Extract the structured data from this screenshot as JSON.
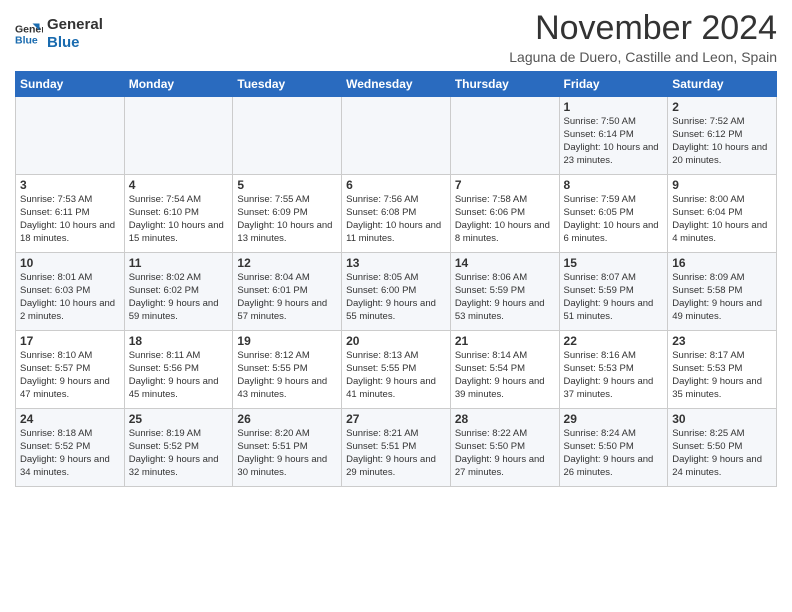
{
  "header": {
    "logo_line1": "General",
    "logo_line2": "Blue",
    "month": "November 2024",
    "location": "Laguna de Duero, Castille and Leon, Spain"
  },
  "weekdays": [
    "Sunday",
    "Monday",
    "Tuesday",
    "Wednesday",
    "Thursday",
    "Friday",
    "Saturday"
  ],
  "weeks": [
    [
      {
        "day": "",
        "info": ""
      },
      {
        "day": "",
        "info": ""
      },
      {
        "day": "",
        "info": ""
      },
      {
        "day": "",
        "info": ""
      },
      {
        "day": "",
        "info": ""
      },
      {
        "day": "1",
        "info": "Sunrise: 7:50 AM\nSunset: 6:14 PM\nDaylight: 10 hours\nand 23 minutes."
      },
      {
        "day": "2",
        "info": "Sunrise: 7:52 AM\nSunset: 6:12 PM\nDaylight: 10 hours\nand 20 minutes."
      }
    ],
    [
      {
        "day": "3",
        "info": "Sunrise: 7:53 AM\nSunset: 6:11 PM\nDaylight: 10 hours\nand 18 minutes."
      },
      {
        "day": "4",
        "info": "Sunrise: 7:54 AM\nSunset: 6:10 PM\nDaylight: 10 hours\nand 15 minutes."
      },
      {
        "day": "5",
        "info": "Sunrise: 7:55 AM\nSunset: 6:09 PM\nDaylight: 10 hours\nand 13 minutes."
      },
      {
        "day": "6",
        "info": "Sunrise: 7:56 AM\nSunset: 6:08 PM\nDaylight: 10 hours\nand 11 minutes."
      },
      {
        "day": "7",
        "info": "Sunrise: 7:58 AM\nSunset: 6:06 PM\nDaylight: 10 hours\nand 8 minutes."
      },
      {
        "day": "8",
        "info": "Sunrise: 7:59 AM\nSunset: 6:05 PM\nDaylight: 10 hours\nand 6 minutes."
      },
      {
        "day": "9",
        "info": "Sunrise: 8:00 AM\nSunset: 6:04 PM\nDaylight: 10 hours\nand 4 minutes."
      }
    ],
    [
      {
        "day": "10",
        "info": "Sunrise: 8:01 AM\nSunset: 6:03 PM\nDaylight: 10 hours\nand 2 minutes."
      },
      {
        "day": "11",
        "info": "Sunrise: 8:02 AM\nSunset: 6:02 PM\nDaylight: 9 hours\nand 59 minutes."
      },
      {
        "day": "12",
        "info": "Sunrise: 8:04 AM\nSunset: 6:01 PM\nDaylight: 9 hours\nand 57 minutes."
      },
      {
        "day": "13",
        "info": "Sunrise: 8:05 AM\nSunset: 6:00 PM\nDaylight: 9 hours\nand 55 minutes."
      },
      {
        "day": "14",
        "info": "Sunrise: 8:06 AM\nSunset: 5:59 PM\nDaylight: 9 hours\nand 53 minutes."
      },
      {
        "day": "15",
        "info": "Sunrise: 8:07 AM\nSunset: 5:59 PM\nDaylight: 9 hours\nand 51 minutes."
      },
      {
        "day": "16",
        "info": "Sunrise: 8:09 AM\nSunset: 5:58 PM\nDaylight: 9 hours\nand 49 minutes."
      }
    ],
    [
      {
        "day": "17",
        "info": "Sunrise: 8:10 AM\nSunset: 5:57 PM\nDaylight: 9 hours\nand 47 minutes."
      },
      {
        "day": "18",
        "info": "Sunrise: 8:11 AM\nSunset: 5:56 PM\nDaylight: 9 hours\nand 45 minutes."
      },
      {
        "day": "19",
        "info": "Sunrise: 8:12 AM\nSunset: 5:55 PM\nDaylight: 9 hours\nand 43 minutes."
      },
      {
        "day": "20",
        "info": "Sunrise: 8:13 AM\nSunset: 5:55 PM\nDaylight: 9 hours\nand 41 minutes."
      },
      {
        "day": "21",
        "info": "Sunrise: 8:14 AM\nSunset: 5:54 PM\nDaylight: 9 hours\nand 39 minutes."
      },
      {
        "day": "22",
        "info": "Sunrise: 8:16 AM\nSunset: 5:53 PM\nDaylight: 9 hours\nand 37 minutes."
      },
      {
        "day": "23",
        "info": "Sunrise: 8:17 AM\nSunset: 5:53 PM\nDaylight: 9 hours\nand 35 minutes."
      }
    ],
    [
      {
        "day": "24",
        "info": "Sunrise: 8:18 AM\nSunset: 5:52 PM\nDaylight: 9 hours\nand 34 minutes."
      },
      {
        "day": "25",
        "info": "Sunrise: 8:19 AM\nSunset: 5:52 PM\nDaylight: 9 hours\nand 32 minutes."
      },
      {
        "day": "26",
        "info": "Sunrise: 8:20 AM\nSunset: 5:51 PM\nDaylight: 9 hours\nand 30 minutes."
      },
      {
        "day": "27",
        "info": "Sunrise: 8:21 AM\nSunset: 5:51 PM\nDaylight: 9 hours\nand 29 minutes."
      },
      {
        "day": "28",
        "info": "Sunrise: 8:22 AM\nSunset: 5:50 PM\nDaylight: 9 hours\nand 27 minutes."
      },
      {
        "day": "29",
        "info": "Sunrise: 8:24 AM\nSunset: 5:50 PM\nDaylight: 9 hours\nand 26 minutes."
      },
      {
        "day": "30",
        "info": "Sunrise: 8:25 AM\nSunset: 5:50 PM\nDaylight: 9 hours\nand 24 minutes."
      }
    ]
  ]
}
